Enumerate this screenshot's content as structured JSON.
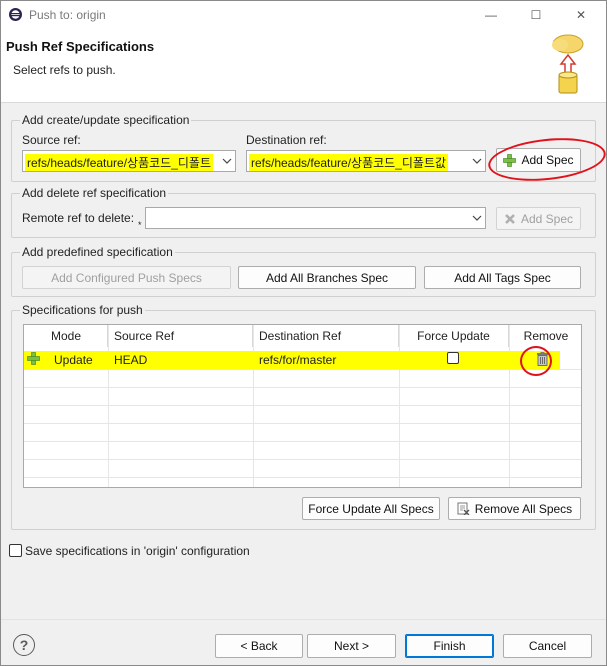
{
  "window": {
    "title": "Push to: origin",
    "minimize": "—",
    "maximize": "☐",
    "close": "✕"
  },
  "header": {
    "title": "Push Ref Specifications",
    "subtitle": "Select refs to push."
  },
  "create_group": {
    "label": "Add create/update specification",
    "source_label": "Source ref:",
    "source_value": "refs/heads/feature/상품코드_디폴트",
    "dest_label": "Destination ref:",
    "dest_value": "refs/heads/feature/상품코드_디폴트값",
    "add_spec": "Add Spec"
  },
  "delete_group": {
    "label": "Add delete ref specification",
    "remote_label": "Remote ref to delete:",
    "required_marker": "*",
    "remote_value": "",
    "add_spec": "Add Spec"
  },
  "predefined_group": {
    "label": "Add predefined specification",
    "configured": "Add Configured Push Specs",
    "all_branches": "Add All Branches Spec",
    "all_tags": "Add All Tags Spec"
  },
  "specs_group": {
    "label": "Specifications for push",
    "columns": [
      "Mode",
      "Source Ref",
      "Destination Ref",
      "Force Update",
      "Remove"
    ],
    "rows": [
      {
        "mode": "Update",
        "source": "HEAD",
        "dest": "refs/for/master",
        "force": false
      }
    ],
    "force_all": "Force Update All Specs",
    "remove_all": "Remove All Specs"
  },
  "save_config": {
    "label": "Save specifications in 'origin' configuration",
    "checked": false
  },
  "footer": {
    "help": "?",
    "back": "< Back",
    "next": "Next >",
    "finish": "Finish",
    "cancel": "Cancel"
  },
  "colors": {
    "highlight": "#ffff00",
    "annotation": "#e0121b",
    "primary_border": "#0078d7"
  }
}
